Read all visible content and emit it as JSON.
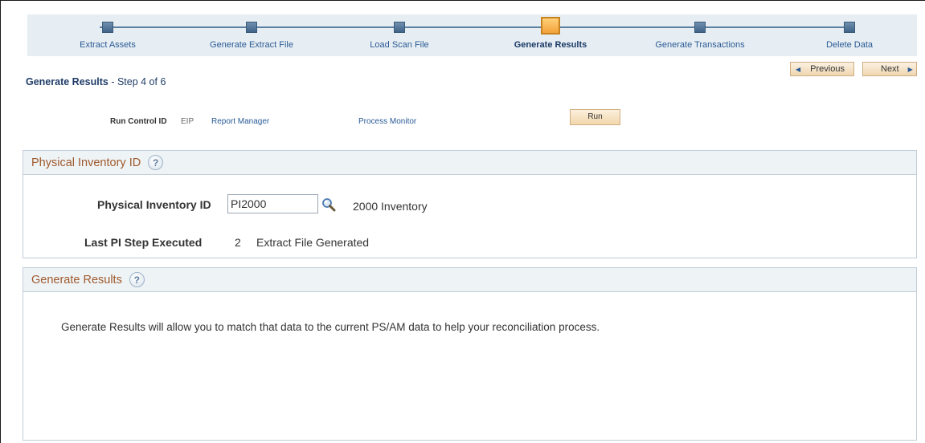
{
  "train": {
    "steps": [
      {
        "label": "Extract Assets"
      },
      {
        "label": "Generate Extract File"
      },
      {
        "label": "Load Scan File"
      },
      {
        "label": "Generate Results"
      },
      {
        "label": "Generate Transactions"
      },
      {
        "label": "Delete Data"
      }
    ],
    "active_step": "Generate Results"
  },
  "nav": {
    "previous_label": "Previous",
    "next_label": "Next"
  },
  "page": {
    "title": "Generate Results",
    "step_text": "- Step 4 of 6"
  },
  "run_control": {
    "label": "Run Control ID",
    "value": "EIP",
    "report_manager": "Report Manager",
    "process_monitor": "Process Monitor",
    "run_label": "Run"
  },
  "physical_inventory": {
    "header": "Physical Inventory ID",
    "id_label": "Physical Inventory ID",
    "id_value": "PI2000",
    "id_description": "2000 Inventory",
    "last_step_label": "Last PI Step Executed",
    "last_step_number": "2",
    "last_step_description": "Extract File Generated"
  },
  "generate_results": {
    "header": "Generate Results",
    "text": "Generate Results will allow you to match that data to the current PS/AM data to help your reconciliation process."
  },
  "help_icon_glyph": "?",
  "colors": {
    "active_step": "#f3a23a",
    "link": "#2a5a95",
    "group_header_text": "#a05a2c"
  }
}
